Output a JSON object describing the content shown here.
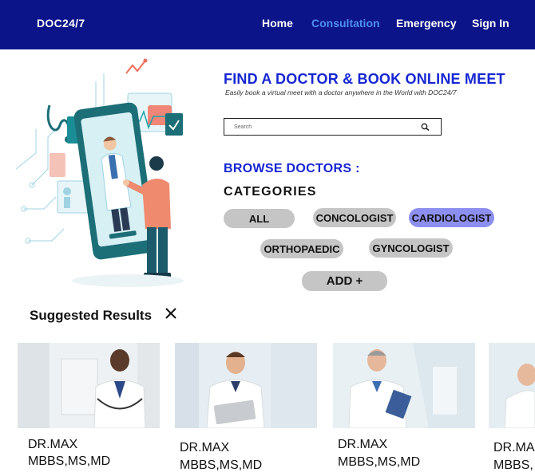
{
  "nav": {
    "brand": "DOC24/7",
    "links": [
      "Home",
      "Consultation",
      "Emergency",
      "Sign In"
    ],
    "active": "Consultation"
  },
  "hero": {
    "title": "FIND A DOCTOR & BOOK ONLINE MEET",
    "subtitle": "Easily book a virtual meet with a doctor anywhere in the World with DOC24/7"
  },
  "search": {
    "placeholder": "Search"
  },
  "browse": {
    "heading": "BROWSE DOCTORS :",
    "categories_heading": "CATEGORIES",
    "categories": [
      "ALL",
      "CONCOLOGIST",
      "CARDIOLOGIST",
      "ORTHOPAEDIC",
      "GYNCOLOGIST"
    ],
    "selected": "CARDIOLOGIST",
    "add_label": "ADD +"
  },
  "suggested": {
    "title": "Suggested Results",
    "cards": [
      {
        "name": "DR.MAX",
        "degree": "MBBS,MS,MD"
      },
      {
        "name": "DR.MAX",
        "degree": "MBBS,MS,MD"
      },
      {
        "name": "DR.MAX",
        "degree": "MBBS,MS,MD"
      },
      {
        "name": "DR.MA",
        "degree": "MBBS,"
      }
    ]
  },
  "colors": {
    "nav_bg": "#0b1489",
    "accent_blue": "#1626d2",
    "active_link": "#4f8ff0",
    "chip_bg": "#c5c5c5",
    "chip_selected": "#8d8ff0"
  }
}
